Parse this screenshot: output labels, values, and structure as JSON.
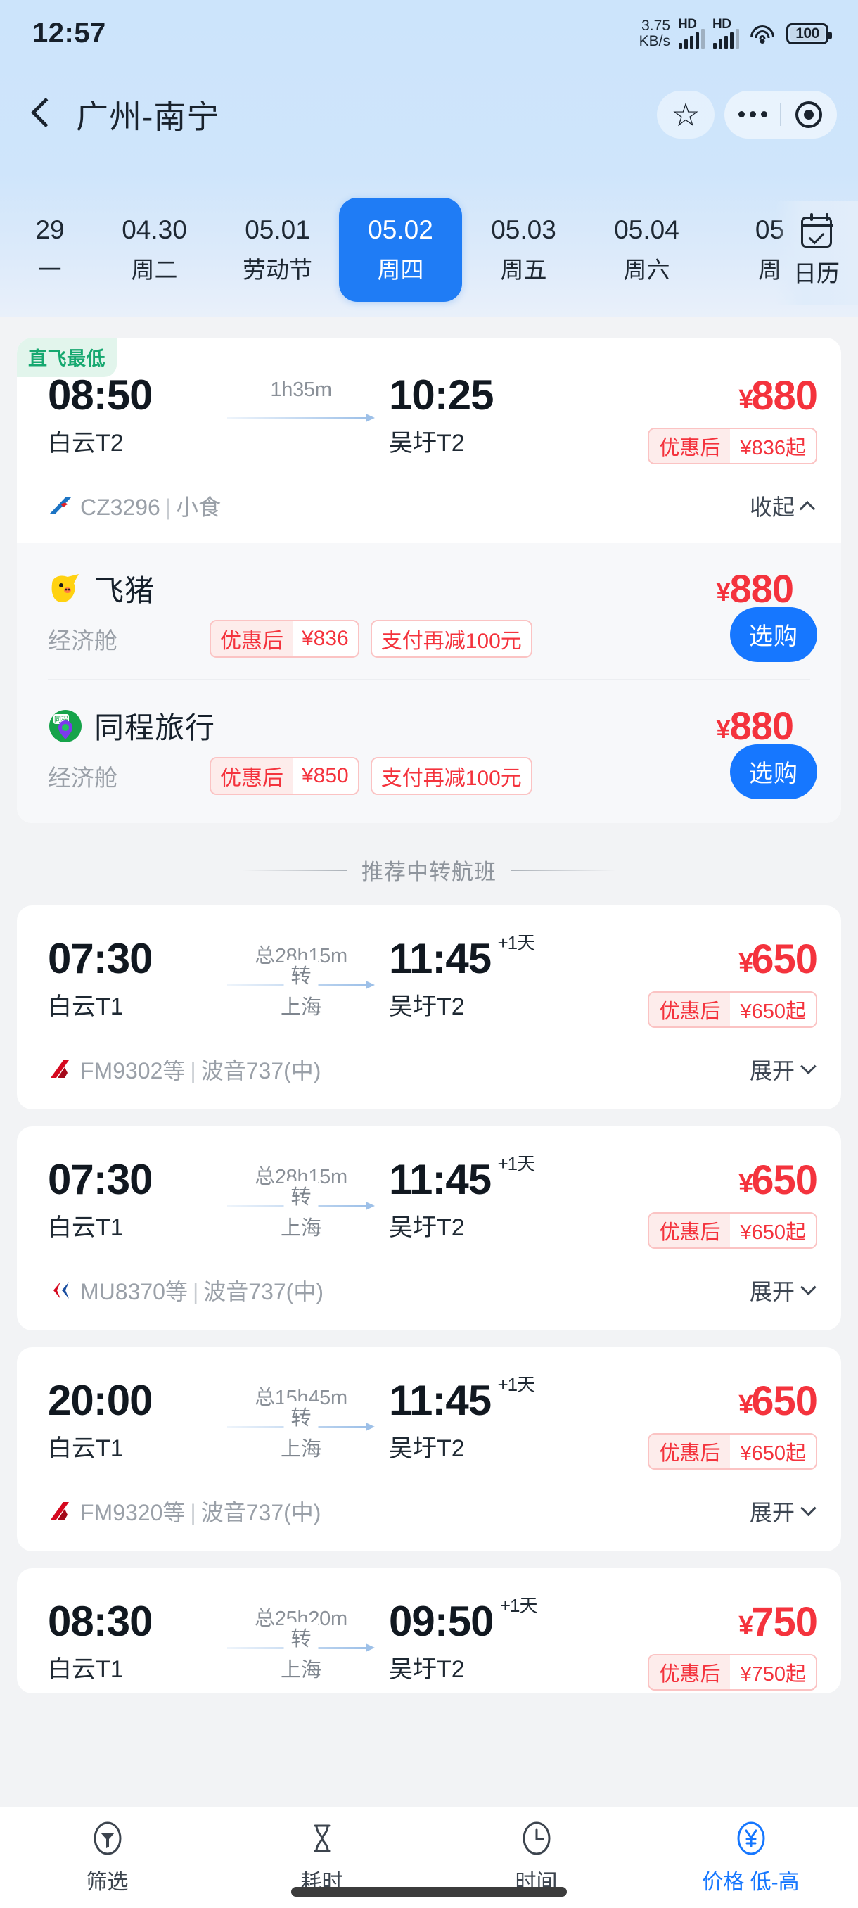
{
  "status_bar": {
    "time": "12:57",
    "net_speed_value": "3.75",
    "net_speed_unit": "KB/s",
    "sim1_label": "HD",
    "sim2_label": "HD",
    "battery": "100"
  },
  "header": {
    "title": "广州-南宁",
    "back_icon": "chevron-left-icon",
    "favorite_icon": "star-icon",
    "more_icon": "more-dots-icon",
    "capsule_icon": "target-circle-icon"
  },
  "date_strip": {
    "items": [
      {
        "date": "29",
        "day": "一",
        "active": false
      },
      {
        "date": "04.30",
        "day": "周二",
        "active": false
      },
      {
        "date": "05.01",
        "day": "劳动节",
        "active": false
      },
      {
        "date": "05.02",
        "day": "周四",
        "active": true
      },
      {
        "date": "05.03",
        "day": "周五",
        "active": false
      },
      {
        "date": "05.04",
        "day": "周六",
        "active": false
      },
      {
        "date": "05",
        "day": "周",
        "active": false
      }
    ],
    "calendar_label": "日历",
    "calendar_icon": "calendar-check-icon"
  },
  "direct_flight": {
    "badge": "直飞最低",
    "depart_time": "08:50",
    "depart_airport": "白云T2",
    "duration": "1h35m",
    "arrive_time": "10:25",
    "arrive_airport": "吴圩T2",
    "price": "880",
    "yen": "¥",
    "promo_label": "优惠后",
    "promo_value": "¥836起",
    "flight_no": "CZ3296",
    "meal": "小食",
    "toggle_label": "收起",
    "airline_logo": "china-southern-logo",
    "ota_list": [
      {
        "name": "飞猪",
        "logo": "fliggy-logo",
        "cabin": "经济舱",
        "price": "880",
        "promo_label": "优惠后",
        "promo_value": "¥836",
        "pay_tag": "支付再减100元",
        "buy_label": "选购"
      },
      {
        "name": "同程旅行",
        "logo": "tongcheng-logo",
        "cabin": "经济舱",
        "price": "880",
        "promo_label": "优惠后",
        "promo_value": "¥850",
        "pay_tag": "支付再减100元",
        "buy_label": "选购"
      }
    ]
  },
  "section_divider": {
    "label": "推荐中转航班"
  },
  "transfer_flights": [
    {
      "depart_time": "07:30",
      "depart_airport": "白云T1",
      "total_duration": "总28h15m",
      "stop_label": "转",
      "stop_city": "上海",
      "arrive_time": "11:45",
      "plus_day": "+1天",
      "arrive_airport": "吴圩T2",
      "price": "650",
      "promo_label": "优惠后",
      "promo_value": "¥650起",
      "flight_no": "FM9302等",
      "aircraft": "波音737(中)",
      "toggle_label": "展开",
      "airline_logo": "shanghai-airlines-logo"
    },
    {
      "depart_time": "07:30",
      "depart_airport": "白云T1",
      "total_duration": "总28h15m",
      "stop_label": "转",
      "stop_city": "上海",
      "arrive_time": "11:45",
      "plus_day": "+1天",
      "arrive_airport": "吴圩T2",
      "price": "650",
      "promo_label": "优惠后",
      "promo_value": "¥650起",
      "flight_no": "MU8370等",
      "aircraft": "波音737(中)",
      "toggle_label": "展开",
      "airline_logo": "china-eastern-logo"
    },
    {
      "depart_time": "20:00",
      "depart_airport": "白云T1",
      "total_duration": "总15h45m",
      "stop_label": "转",
      "stop_city": "上海",
      "arrive_time": "11:45",
      "plus_day": "+1天",
      "arrive_airport": "吴圩T2",
      "price": "650",
      "promo_label": "优惠后",
      "promo_value": "¥650起",
      "flight_no": "FM9320等",
      "aircraft": "波音737(中)",
      "toggle_label": "展开",
      "airline_logo": "shanghai-airlines-logo"
    },
    {
      "depart_time": "08:30",
      "depart_airport": "白云T1",
      "total_duration": "总25h20m",
      "stop_label": "转",
      "stop_city": "上海",
      "arrive_time": "09:50",
      "plus_day": "+1天",
      "arrive_airport": "吴圩T2",
      "price": "750",
      "promo_label": "优惠后",
      "promo_value": "¥750起",
      "flight_no": "",
      "aircraft": "",
      "toggle_label": "",
      "airline_logo": ""
    }
  ],
  "bottom_bar": {
    "items": [
      {
        "label": "筛选",
        "icon": "filter-funnel-icon",
        "active": false
      },
      {
        "label": "耗时",
        "icon": "hourglass-icon",
        "active": false
      },
      {
        "label": "时间",
        "icon": "clock-icon",
        "active": false
      },
      {
        "label": "价格 低-高",
        "icon": "yen-circle-icon",
        "active": true
      }
    ]
  },
  "colors": {
    "accent_blue": "#1677ff",
    "price_red": "#f4333d",
    "badge_green": "#16a870",
    "top_gradient_start": "#cce4fb"
  }
}
